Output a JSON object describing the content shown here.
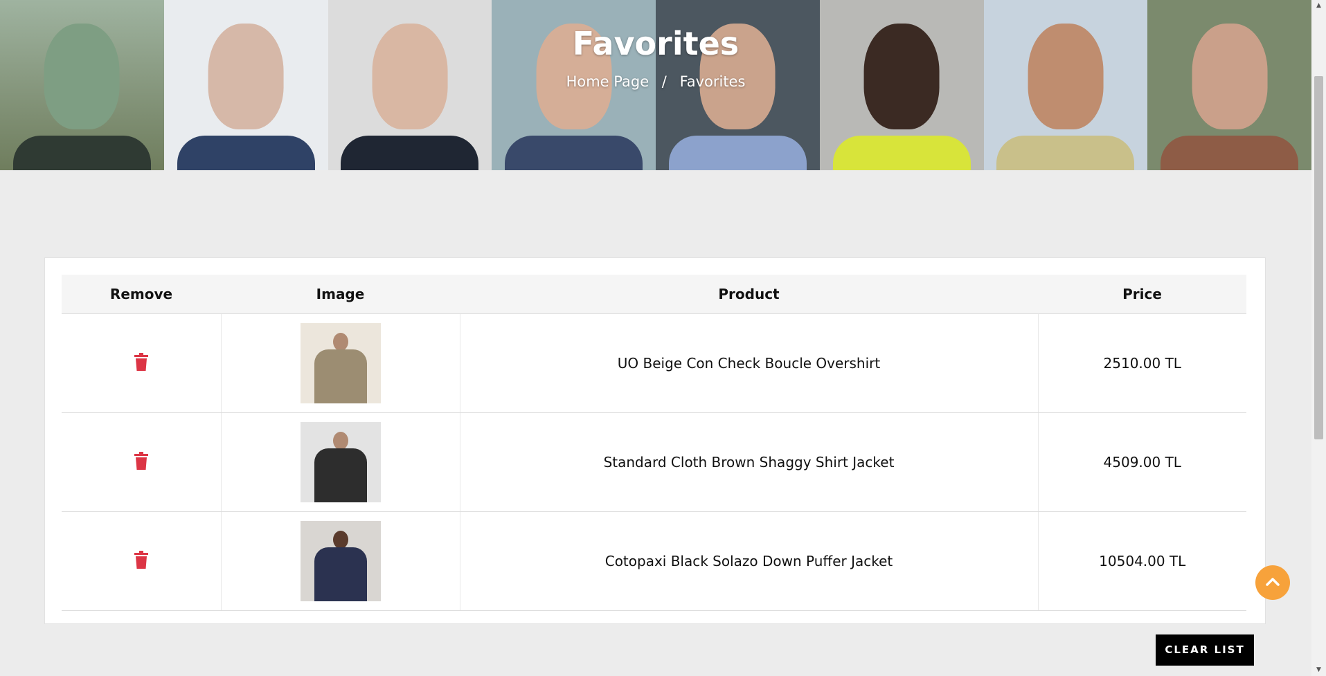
{
  "header": {
    "title": "Favorites",
    "breadcrumb": {
      "home": "Home Page",
      "separator": "/",
      "current": "Favorites"
    }
  },
  "table": {
    "columns": [
      "Remove",
      "Image",
      "Product",
      "Price"
    ],
    "rows": [
      {
        "product": "UO Beige Con Check Boucle Overshirt",
        "price": "2510.00 TL"
      },
      {
        "product": "Standard Cloth Brown Shaggy Shirt Jacket",
        "price": "4509.00 TL"
      },
      {
        "product": "Cotopaxi Black Solazo Down Puffer Jacket",
        "price": "10504.00 TL"
      }
    ]
  },
  "actions": {
    "clear_list": "CLEAR LIST"
  },
  "icons": {
    "remove": "trash-icon",
    "back_to_top": "chevron-up-icon"
  },
  "colors": {
    "trash": "#dc3545",
    "back_to_top": "#f7a23b",
    "clear_button": "#000000"
  }
}
